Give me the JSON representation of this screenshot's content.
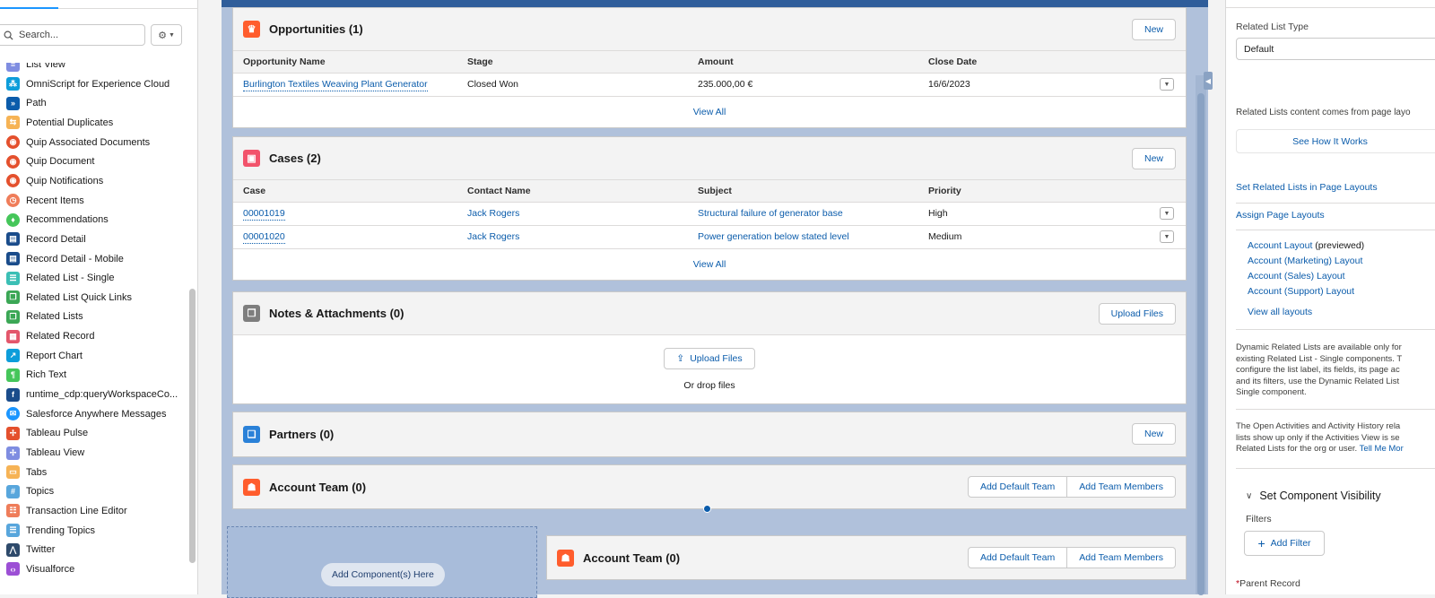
{
  "left_panel": {
    "search_placeholder": "Search...",
    "gear_icon": "gear-icon",
    "items": [
      {
        "label": "List View",
        "color": "#7f8de1",
        "glyph": "≡"
      },
      {
        "label": "OmniScript for Experience Cloud",
        "color": "#0d9dda",
        "glyph": "⁂"
      },
      {
        "label": "Path",
        "color": "#0b5cab",
        "glyph": "»"
      },
      {
        "label": "Potential Duplicates",
        "color": "#f6b355",
        "glyph": "⇆"
      },
      {
        "label": "Quip Associated Documents",
        "color": "#e4502d",
        "glyph": "◉"
      },
      {
        "label": "Quip Document",
        "color": "#e4502d",
        "glyph": "◉"
      },
      {
        "label": "Quip Notifications",
        "color": "#e4502d",
        "glyph": "◉"
      },
      {
        "label": "Recent Items",
        "color": "#ef7d5a",
        "glyph": "◷"
      },
      {
        "label": "Recommendations",
        "color": "#45c65a",
        "glyph": "♦"
      },
      {
        "label": "Record Detail",
        "color": "#1a4c8b",
        "glyph": "▤"
      },
      {
        "label": "Record Detail - Mobile",
        "color": "#1a4c8b",
        "glyph": "▤"
      },
      {
        "label": "Related List - Single",
        "color": "#3bbfb5",
        "glyph": "☰"
      },
      {
        "label": "Related List Quick Links",
        "color": "#3ba755",
        "glyph": "❐"
      },
      {
        "label": "Related Lists",
        "color": "#3ba755",
        "glyph": "❐"
      },
      {
        "label": "Related Record",
        "color": "#e3566b",
        "glyph": "▦"
      },
      {
        "label": "Report Chart",
        "color": "#0d9dda",
        "glyph": "↗"
      },
      {
        "label": "Rich Text",
        "color": "#45c65a",
        "glyph": "¶"
      },
      {
        "label": "runtime_cdp:queryWorkspaceCo...",
        "color": "#1a4c8b",
        "glyph": "f"
      },
      {
        "label": "Salesforce Anywhere Messages",
        "color": "#1b96ff",
        "glyph": "✉"
      },
      {
        "label": "Tableau Pulse",
        "color": "#e4502d",
        "glyph": "✢"
      },
      {
        "label": "Tableau View",
        "color": "#7f8de1",
        "glyph": "✢"
      },
      {
        "label": "Tabs",
        "color": "#f6b355",
        "glyph": "▭"
      },
      {
        "label": "Topics",
        "color": "#58a6dc",
        "glyph": "#"
      },
      {
        "label": "Transaction Line Editor",
        "color": "#ef7d5a",
        "glyph": "☷"
      },
      {
        "label": "Trending Topics",
        "color": "#58a6dc",
        "glyph": "☰"
      },
      {
        "label": "Twitter",
        "color": "#2e4a6b",
        "glyph": "⋀"
      },
      {
        "label": "Visualforce",
        "color": "#9c4fd5",
        "glyph": "‹›"
      }
    ]
  },
  "canvas": {
    "opportunities": {
      "title": "Opportunities (1)",
      "new_label": "New",
      "columns": [
        "Opportunity Name",
        "Stage",
        "Amount",
        "Close Date"
      ],
      "rows": [
        {
          "name": "Burlington Textiles Weaving Plant Generator",
          "stage": "Closed Won",
          "amount": "235.000,00 €",
          "close": "16/6/2023"
        }
      ],
      "view_all": "View All",
      "icon_color": "#ff5d2d"
    },
    "cases": {
      "title": "Cases (2)",
      "new_label": "New",
      "columns": [
        "Case",
        "Contact Name",
        "Subject",
        "Priority"
      ],
      "rows": [
        {
          "case": "00001019",
          "contact": "Jack Rogers",
          "subject": "Structural failure of generator base",
          "priority": "High"
        },
        {
          "case": "00001020",
          "contact": "Jack Rogers",
          "subject": "Power generation below stated level",
          "priority": "Medium"
        }
      ],
      "view_all": "View All",
      "icon_color": "#f2536b"
    },
    "notes": {
      "title": "Notes & Attachments (0)",
      "upload_label": "Upload Files",
      "drop_text": "Or drop files",
      "icon_color": "#7e7e7e"
    },
    "partners": {
      "title": "Partners (0)",
      "new_label": "New",
      "icon_color": "#2a81d8"
    },
    "account_team": {
      "title": "Account Team (0)",
      "add_default": "Add Default Team",
      "add_members": "Add Team Members",
      "icon_color": "#ff5d2d"
    },
    "dropzone_label": "Add Component(s) Here",
    "account_team_2": {
      "title": "Account Team (0)",
      "add_default": "Add Default Team",
      "add_members": "Add Team Members"
    }
  },
  "right_panel": {
    "related_list_type_label": "Related List Type",
    "related_list_type_value": "Default",
    "content_note": "Related Lists content comes from page layo",
    "see_how": "See How It Works",
    "set_in_layouts": "Set Related Lists in Page Layouts",
    "assign_layouts": "Assign Page Layouts",
    "layouts": [
      {
        "link": "Account Layout",
        "suffix": " (previewed)"
      },
      {
        "link": "Account (Marketing) Layout",
        "suffix": ""
      },
      {
        "link": "Account (Sales) Layout",
        "suffix": ""
      },
      {
        "link": "Account (Support) Layout",
        "suffix": ""
      }
    ],
    "view_all_layouts": "View all layouts",
    "dynamic_text": [
      "Dynamic Related Lists are available only for",
      "existing Related List - Single components. T",
      "configure the list label, its fields, its page ac",
      "and its filters, use the Dynamic Related List",
      "Single component."
    ],
    "activity_text": [
      "The Open Activities and Activity History rela",
      "lists show up only if the Activities View is se",
      "Related Lists for the org or user."
    ],
    "tell_me_more": "Tell Me Mor",
    "visibility_heading": "Set Component Visibility",
    "filters_label": "Filters",
    "add_filter": "Add Filter",
    "parent_record": "Parent Record",
    "required_marker": "*"
  }
}
